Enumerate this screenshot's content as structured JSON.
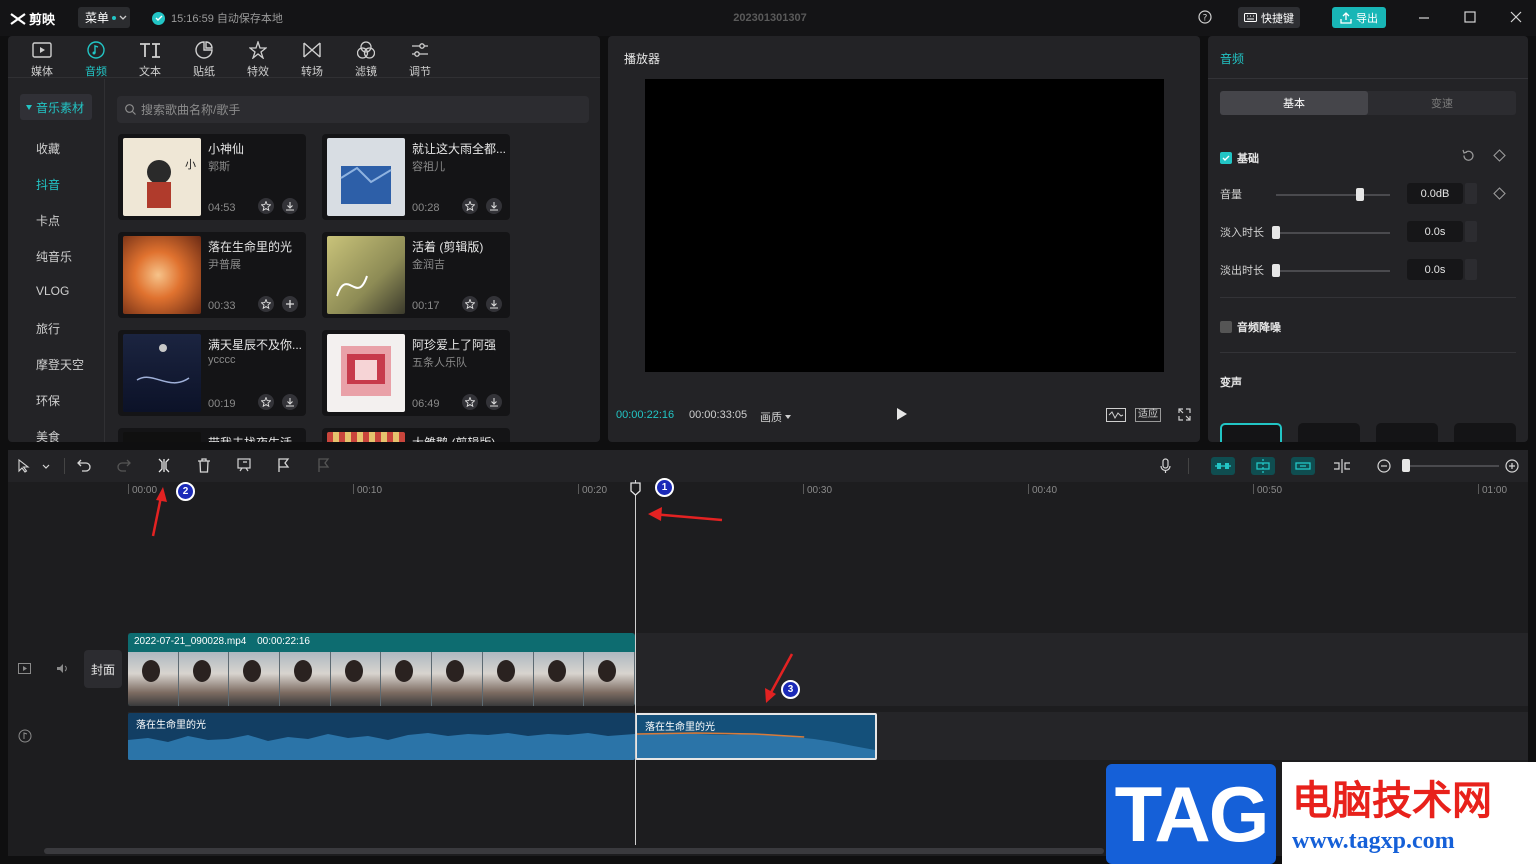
{
  "app": {
    "logo": "剪映",
    "menu_label": "菜单",
    "autosave": "15:16:59 自动保存本地",
    "project_name": "202301301307",
    "shortcut_label": "快捷键",
    "export_label": "导出"
  },
  "media": {
    "tabs": [
      "媒体",
      "音频",
      "文本",
      "贴纸",
      "特效",
      "转场",
      "滤镜",
      "调节"
    ],
    "active_tab": "音频",
    "active_category": "音乐素材",
    "categories": [
      "收藏",
      "抖音",
      "卡点",
      "纯音乐",
      "VLOG",
      "旅行",
      "摩登天空",
      "环保",
      "美食"
    ],
    "search_placeholder": "搜索歌曲名称/歌手",
    "songs": [
      {
        "title": "小神仙",
        "artist": "郭斯",
        "duration": "04:53"
      },
      {
        "title": "就让这大雨全都...",
        "artist": "容祖儿",
        "duration": "00:28"
      },
      {
        "title": "落在生命里的光",
        "artist": "尹普展",
        "duration": "00:33"
      },
      {
        "title": "活着 (剪辑版)",
        "artist": "金润吉",
        "duration": "00:17"
      },
      {
        "title": "满天星辰不及你...",
        "artist": "ycccc",
        "duration": "00:19"
      },
      {
        "title": "阿珍爱上了阿强",
        "artist": "五条人乐队",
        "duration": "06:49"
      },
      {
        "title": "带我去找夜生活",
        "artist": "",
        "duration": ""
      },
      {
        "title": "大雏鹅 (剪辑版)",
        "artist": "",
        "duration": ""
      }
    ]
  },
  "player": {
    "title": "播放器",
    "current_time": "00:00:22:16",
    "total_time": "00:00:33:05",
    "quality_label": "画质",
    "fit_label": "适应"
  },
  "props": {
    "title": "音频",
    "tab_basic": "基本",
    "tab_speed": "变速",
    "basic_label": "基础",
    "volume_label": "音量",
    "volume_value": "0.0dB",
    "volume_level": 0.74,
    "fadein_label": "淡入时长",
    "fadein_value": "0.0s",
    "fadeout_label": "淡出时长",
    "fadeout_value": "0.0s",
    "denoise_label": "音频降噪",
    "voice_change_label": "变声"
  },
  "timeline": {
    "ruler": [
      "00:00",
      "00:10",
      "00:20",
      "00:30",
      "00:40",
      "00:50",
      "01:00"
    ],
    "cover_label": "封面",
    "video_clip_name": "2022-07-21_090028.mp4",
    "video_clip_duration": "00:00:22:16",
    "audio_clip_left": "落在生命里的光",
    "audio_clip_right": "落在生命里的光"
  },
  "annotations": [
    "1",
    "2",
    "3"
  ],
  "watermark": {
    "big": "TAG",
    "cn": "电脑技术网",
    "url": "www.tagxp.com"
  },
  "colors": {
    "accent": "#22c5c5",
    "export": "#18b6b6",
    "video_clip": "#0d6c70",
    "audio_clip": "#123e63",
    "annotation": "#1b2ab8",
    "arrow": "#e32222"
  }
}
